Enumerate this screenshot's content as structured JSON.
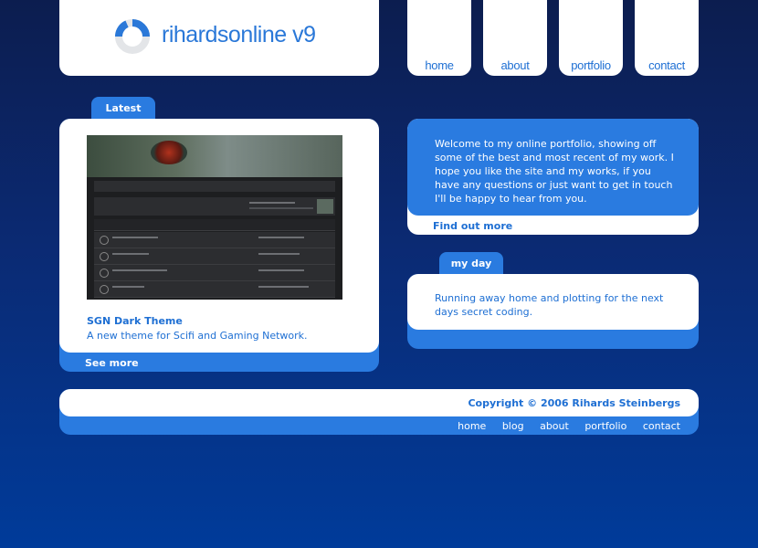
{
  "logo": {
    "text": "rihardsonline v9",
    "icon": "ring-logo-icon"
  },
  "nav": [
    {
      "label": "home"
    },
    {
      "label": "about"
    },
    {
      "label": "portfolio"
    },
    {
      "label": "contact"
    }
  ],
  "latest": {
    "tab_label": "Latest",
    "item_title": "SGN Dark Theme",
    "item_desc": "A new theme for Scifi and Gaming Network.",
    "see_more": "See more"
  },
  "welcome": {
    "text": "Welcome to my online portfolio, showing off some of the best and most recent of my work. I hope you like the site and my works, if you have any questions or just want to get in touch I'll be happy to hear from you.",
    "find_out_more": "Find out more"
  },
  "myday": {
    "tab_label": "my day",
    "text": "Running away home and plotting for the next days secret coding."
  },
  "footer": {
    "copyright": "Copyright © 2006 Rihards Steinbergs",
    "links": [
      "home",
      "blog",
      "about",
      "portfolio",
      "contact"
    ]
  },
  "colors": {
    "accent": "#2a7be0",
    "text_blue": "#1e6fd3",
    "panel": "#ffffff"
  }
}
